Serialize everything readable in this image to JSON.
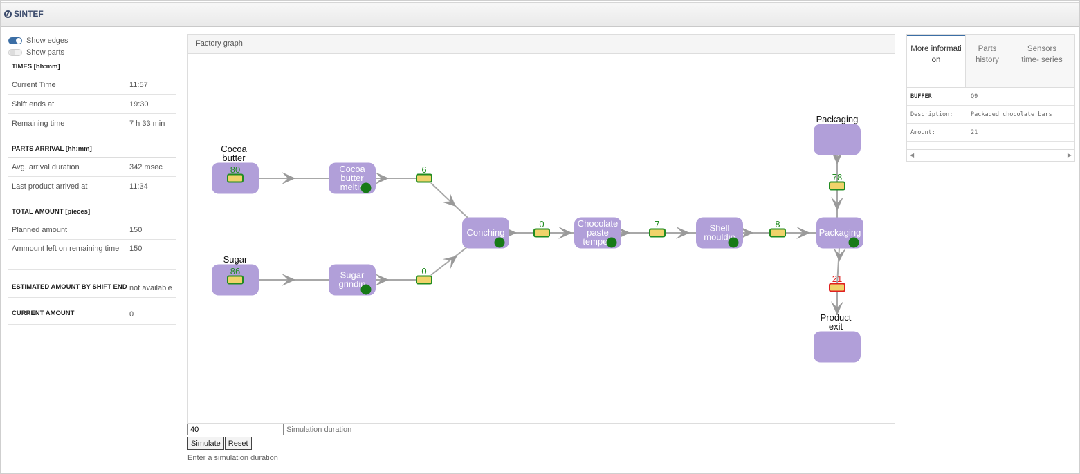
{
  "app": {
    "logo_text": "SINTEF"
  },
  "toggles": [
    {
      "label": "Show edges",
      "on": true
    },
    {
      "label": "Show parts",
      "on": false
    }
  ],
  "times": {
    "heading": "TIMES [hh:mm]",
    "rows": [
      {
        "label": "Current Time",
        "value": "11:57"
      },
      {
        "label": "Shift ends at",
        "value": "19:30"
      },
      {
        "label": "Remaining time",
        "value": "7 h 33 min"
      }
    ]
  },
  "arrival": {
    "heading": "PARTS ARRIVAL [hh:mm]",
    "rows": [
      {
        "label": "Avg. arrival duration",
        "value": "342 msec"
      },
      {
        "label": "Last product arrived at",
        "value": "11:34"
      }
    ]
  },
  "total": {
    "heading": "TOTAL AMOUNT [pieces]",
    "rows": [
      {
        "label": "Planned amount",
        "value": "150"
      },
      {
        "label": "Ammount left on remaining time",
        "value": "150"
      }
    ]
  },
  "estimated": {
    "label": "ESTIMATED AMOUNT BY SHIFT END",
    "value": "not available"
  },
  "current": {
    "label": "CURRENT AMOUNT",
    "value": "0"
  },
  "graph": {
    "title": "Factory graph",
    "nodes": {
      "cocoa_butter_src": {
        "label": [
          "Cocoa",
          "butter"
        ]
      },
      "sugar_src": {
        "label": [
          "Sugar"
        ]
      },
      "cocoa_melting": {
        "label": [
          "Cocoa",
          "butter",
          "meltin"
        ]
      },
      "sugar_grinding": {
        "label": [
          "Sugar",
          "grindin"
        ]
      },
      "conching": {
        "label": [
          "Conching"
        ]
      },
      "tempering": {
        "label": [
          "Chocolate",
          "paste",
          "temperi"
        ]
      },
      "shell": {
        "label": [
          "Shell",
          "mouldin"
        ]
      },
      "packaging": {
        "label": [
          "Packaging"
        ]
      },
      "packaging_src": {
        "label": [
          "Packaging"
        ]
      },
      "exit": {
        "label": [
          "Product",
          "exit"
        ]
      }
    },
    "buffers": {
      "cocoa_src": "80",
      "sugar_src": "86",
      "after_melting": "6",
      "after_grinding": "0",
      "after_conching": "0",
      "after_tempering": "7",
      "after_shell": "8",
      "packaging_in": "78",
      "packaging_out": "21"
    },
    "colors": {
      "node": "#b19fd9",
      "buffer_ok": "#218c21",
      "buffer_alert": "#e02020",
      "buffer_fill": "#f0d36a",
      "status_dot": "#177a17",
      "edge": "#a8a8a8"
    }
  },
  "simulation": {
    "value": "40",
    "duration_label": "Simulation duration",
    "simulate_label": "Simulate",
    "reset_label": "Reset",
    "hint": "Enter a simulation duration"
  },
  "info_panel": {
    "tabs": [
      "More informati on",
      "Parts history",
      "Sensors time- series"
    ],
    "rows": [
      {
        "label": "BUFFER",
        "value": "Q9"
      },
      {
        "label": "Description:",
        "value": "Packaged chocolate bars"
      },
      {
        "label": "Amount:",
        "value": "21"
      }
    ]
  }
}
